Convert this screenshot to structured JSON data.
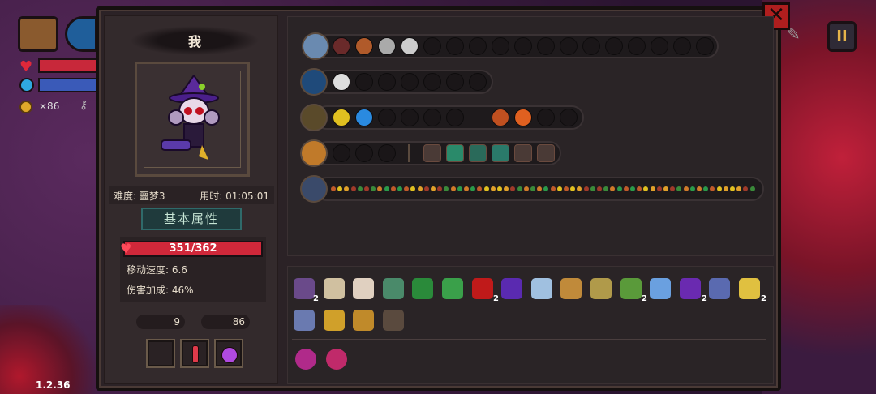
{
  "hud": {
    "coins": "×86",
    "version": "1.2.36",
    "pause_icon": "pause-icon"
  },
  "character": {
    "name": "我",
    "difficulty": "难度: 噩梦3",
    "time_used": "用时: 01:05:01",
    "tab_label": "基本属性",
    "hp_text": "351/362",
    "hp_fraction": 0.97,
    "move_speed": "移动速度: 6.6",
    "damage_bonus": "伤害加成: 46%",
    "keys": "9",
    "gold": "86"
  },
  "colors": {
    "accent_teal": "#2f6a6a",
    "hp_red": "#d0283a",
    "gold": "#e0a82a",
    "close_red": "#b01e1e"
  },
  "tracks": [
    {
      "icon": "chest-icon",
      "filled": 5,
      "sockets": 13
    },
    {
      "icon": "staff-icon",
      "filled": 1,
      "sockets": 6
    },
    {
      "icon": "wand-icon",
      "filled": 2,
      "sockets": 6
    },
    {
      "icon": "gem-icon",
      "filled": 0,
      "sockets": 3
    },
    {
      "icon": "scepter-icon",
      "filled": 0,
      "sockets": 0
    }
  ],
  "item_counts": {
    "witch_hat_portrait": "2",
    "red_eye": "2",
    "hook": "2",
    "purple_hat": "2",
    "hourglass": "2"
  },
  "icons": {
    "close": "close-icon",
    "key": "key-icon",
    "coin": "coin-icon",
    "heart": "heart-icon",
    "pencil": "pencil-icon"
  }
}
